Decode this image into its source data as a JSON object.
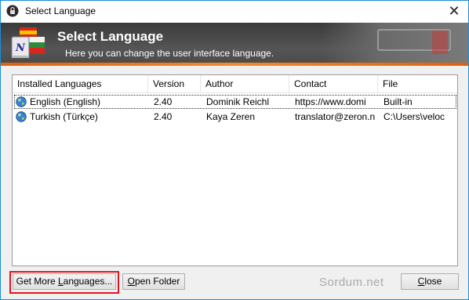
{
  "window": {
    "title": "Select Language",
    "close_glyph": "✕"
  },
  "banner": {
    "heading": "Select Language",
    "subheading": "Here you can change the user interface language."
  },
  "columns": [
    "Installed Languages",
    "Version",
    "Author",
    "Contact",
    "File"
  ],
  "rows": [
    {
      "language": "English (English)",
      "version": "2.40",
      "author": "Dominik Reichl",
      "contact": "https://www.domi",
      "file": "Built-in",
      "selected": true
    },
    {
      "language": "Turkish (Türkçe)",
      "version": "2.40",
      "author": "Kaya Zeren",
      "contact": "translator@zeron.n",
      "file": "C:\\Users\\veloc",
      "selected": false
    }
  ],
  "buttons": {
    "get_more_pre": "Get More ",
    "get_more_mn": "L",
    "get_more_post": "anguages...",
    "open_pre": "",
    "open_mn": "O",
    "open_post": "pen Folder",
    "close_pre": "",
    "close_mn": "C",
    "close_post": "lose"
  },
  "watermark": "Sordum.net",
  "colors": {
    "accent_stripe": "#f28a2a",
    "highlight": "#e0141e",
    "window_border": "#1a8fd6"
  },
  "icons": {
    "app": "lock-icon",
    "banner": "language-flags-icon",
    "row": "globe-icon"
  }
}
